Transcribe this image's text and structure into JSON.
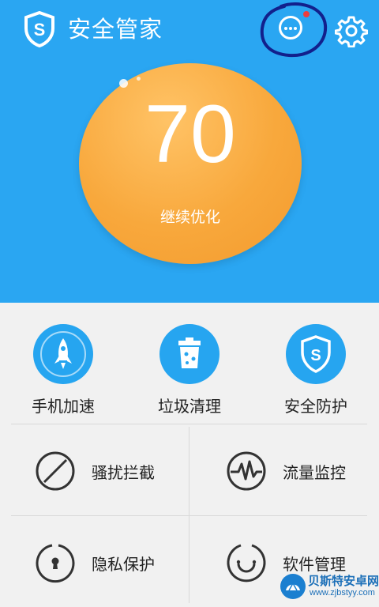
{
  "app": {
    "title": "安全管家",
    "logo_letter": "S"
  },
  "header": {
    "colors": {
      "background": "#2aa6f2",
      "notification_dot": "#ee3d3d"
    }
  },
  "score": {
    "value": "70",
    "action": "继续优化",
    "color": "#f6a53a"
  },
  "features": [
    {
      "label": "手机加速",
      "icon": "rocket-icon"
    },
    {
      "label": "垃圾清理",
      "icon": "trash-icon"
    },
    {
      "label": "安全防护",
      "icon": "shield-icon"
    }
  ],
  "tools": [
    {
      "label": "骚扰拦截",
      "icon": "block-icon"
    },
    {
      "label": "流量监控",
      "icon": "pulse-icon"
    },
    {
      "label": "隐私保护",
      "icon": "lock-icon"
    },
    {
      "label": "软件管理",
      "icon": "apps-icon"
    }
  ],
  "watermark": {
    "name": "贝斯特安卓网",
    "url": "www.zjbstyy.com"
  }
}
